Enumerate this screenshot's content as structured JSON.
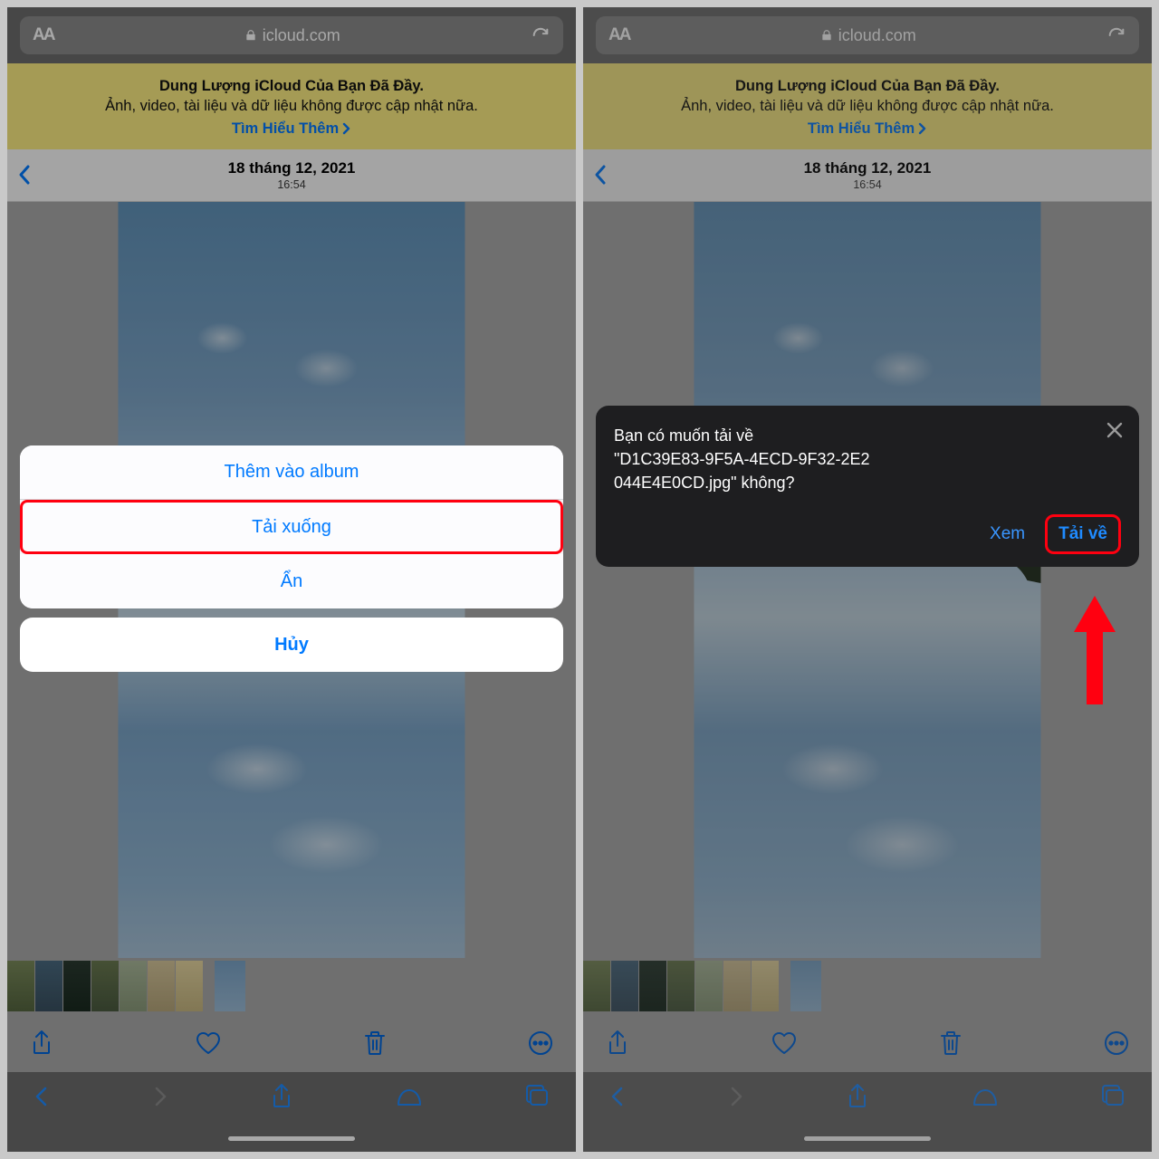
{
  "addressbar": {
    "aa": "AA",
    "url": "icloud.com"
  },
  "banner": {
    "title": "Dung Lượng iCloud Của Bạn Đã Đầy.",
    "body": "Ảnh, video, tài liệu và dữ liệu không được cập nhật nữa.",
    "link": "Tìm Hiểu Thêm"
  },
  "header": {
    "date": "18 tháng 12, 2021",
    "time": "16:54"
  },
  "sheet": {
    "add": "Thêm vào album",
    "download": "Tải xuống",
    "hide": "Ẩn",
    "cancel": "Hủy"
  },
  "dialog": {
    "line1": "Bạn có muốn tải về",
    "line2": "\"D1C39E83-9F5A-4ECD-9F32-2E2",
    "line3": "044E4E0CD.jpg\" không?",
    "view": "Xem",
    "download": "Tải về"
  }
}
